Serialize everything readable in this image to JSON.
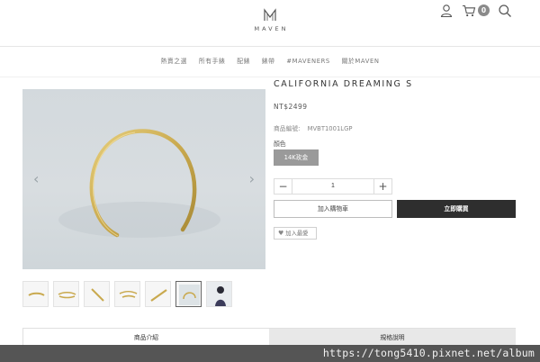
{
  "header": {
    "logo_text": "MAVEN",
    "cart_count": "0",
    "icons": [
      "user-icon",
      "cart-icon",
      "search-icon"
    ]
  },
  "nav": {
    "items": [
      "熱賣之選",
      "所有手錶",
      "配錶",
      "錶帶",
      "#MAVENERS",
      "關於MAVEN"
    ]
  },
  "product": {
    "title": "CALIFORNIA DREAMING S",
    "price": "NT$2499",
    "sku_label": "商品編號:",
    "sku_value": "MVBT1001LGP",
    "color_label": "顏色",
    "color_option": "14K玫金",
    "quantity": "1",
    "add_to_cart": "加入購物車",
    "buy_now": "立即購買",
    "wishlist": "加入最愛"
  },
  "gallery": {
    "prev_arrow": "‹",
    "next_arrow": "›",
    "thumb_count": 7,
    "active_thumb": 6
  },
  "tabs": [
    "商品介紹",
    "規格說明"
  ],
  "watermark": "https://tong5410.pixnet.net/album",
  "colors": {
    "accent_dark": "#2e2e2e",
    "color_chip": "#9a9a9a",
    "gold": "#c9a94e"
  }
}
